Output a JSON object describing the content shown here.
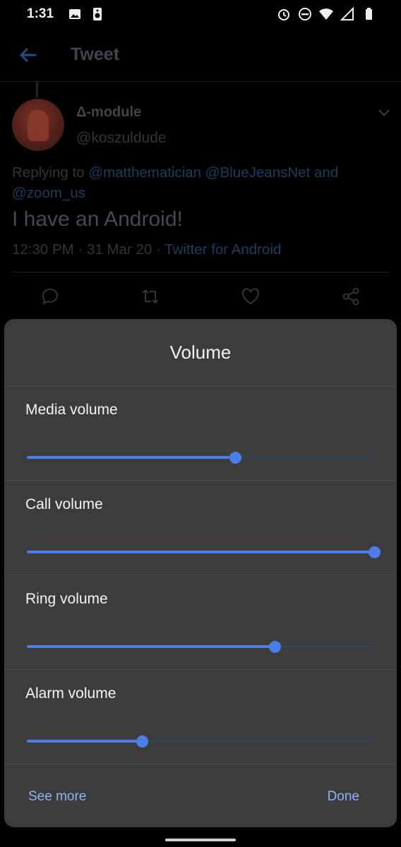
{
  "status_bar": {
    "time": "1:31",
    "left_icons": [
      "image-icon",
      "speaker-icon"
    ],
    "right_icons": [
      "alarm-icon",
      "dnd-icon",
      "wifi-icon",
      "signal-icon",
      "battery-icon"
    ]
  },
  "tweet_screen": {
    "header_title": "Tweet",
    "author_name": "Δ-module",
    "author_handle": "@koszuldude",
    "replying_prefix": "Replying to",
    "mentions": [
      "@matthematician",
      "@BlueJeansNet",
      "and",
      "@zoom_us"
    ],
    "text": "I have an Android!",
    "timestamp": "12:30 PM · 31 Mar 20 ·",
    "source": "Twitter for Android",
    "actions": [
      "reply-icon",
      "retweet-icon",
      "like-icon",
      "share-icon"
    ]
  },
  "volume_panel": {
    "title": "Volume",
    "sliders": [
      {
        "label": "Media volume",
        "level": 0.6
      },
      {
        "label": "Call volume",
        "level": 1.0
      },
      {
        "label": "Ring volume",
        "level": 0.715
      },
      {
        "label": "Alarm volume",
        "level": 0.333
      }
    ],
    "see_more": "See more",
    "done": "Done"
  },
  "colors": {
    "accent": "#4b7ee8",
    "panel_bg": "#3c3c3c",
    "link": "#8fb3f5"
  }
}
